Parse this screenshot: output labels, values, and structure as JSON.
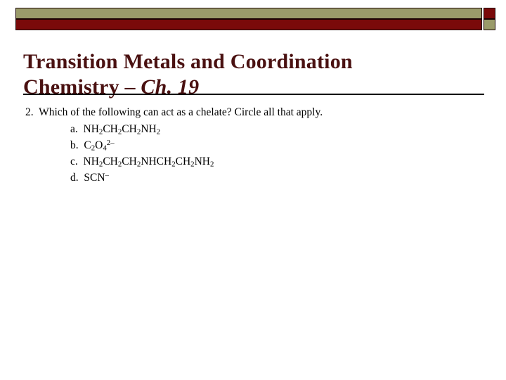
{
  "slide": {
    "title_line1": "Transition Metals and Coordination",
    "title_line2_prefix": "Chemistry – ",
    "title_line2_italic": "Ch. 19",
    "title_color": "#4a1111"
  },
  "banner": {
    "olive_color": "#9a9b6a",
    "maroon_color": "#7a0a0a",
    "outline_color": "#1a0404"
  },
  "divider": {
    "color": "#000000"
  },
  "body": {
    "question": "2.  Which of the following can act as a chelate? Circle all that apply.",
    "choices": [
      {
        "label": "a.",
        "formula_plain": "NH2CH2CH2NH2",
        "parts": [
          {
            "t": "NH",
            "k": "n"
          },
          {
            "t": "2",
            "k": "sub"
          },
          {
            "t": "CH",
            "k": "n"
          },
          {
            "t": "2",
            "k": "sub"
          },
          {
            "t": "CH",
            "k": "n"
          },
          {
            "t": "2",
            "k": "sub"
          },
          {
            "t": "NH",
            "k": "n"
          },
          {
            "t": "2",
            "k": "sub"
          }
        ]
      },
      {
        "label": "b.",
        "formula_plain": "C2O4 2-",
        "parts": [
          {
            "t": "C",
            "k": "n"
          },
          {
            "t": "2",
            "k": "sub"
          },
          {
            "t": "O",
            "k": "n"
          },
          {
            "t": "4",
            "k": "sub"
          },
          {
            "t": "2–",
            "k": "sup"
          }
        ]
      },
      {
        "label": "c.",
        "formula_plain": "NH2CH2CH2NHCH2CH2NH2",
        "parts": [
          {
            "t": "NH",
            "k": "n"
          },
          {
            "t": "2",
            "k": "sub"
          },
          {
            "t": "CH",
            "k": "n"
          },
          {
            "t": "2",
            "k": "sub"
          },
          {
            "t": "CH",
            "k": "n"
          },
          {
            "t": "2",
            "k": "sub"
          },
          {
            "t": "NHCH",
            "k": "n"
          },
          {
            "t": "2",
            "k": "sub"
          },
          {
            "t": "CH",
            "k": "n"
          },
          {
            "t": "2",
            "k": "sub"
          },
          {
            "t": "NH",
            "k": "n"
          },
          {
            "t": "2",
            "k": "sub"
          }
        ]
      },
      {
        "label": "d.",
        "formula_plain": "SCN-",
        "parts": [
          {
            "t": "SCN",
            "k": "n"
          },
          {
            "t": "–",
            "k": "sup"
          }
        ]
      }
    ]
  }
}
